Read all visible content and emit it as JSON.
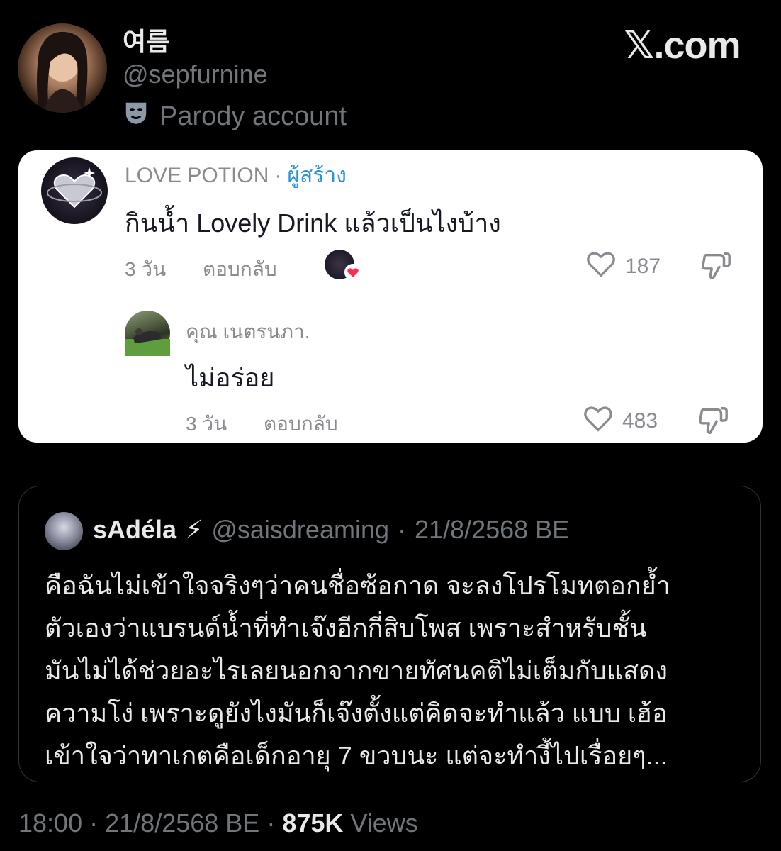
{
  "author": {
    "display_name": "여름",
    "handle": "@sepfurnine",
    "parody_label": "Parody account",
    "parody_icon": "mask-icon"
  },
  "brand": "𝕏.com",
  "screenshot": {
    "comment": {
      "author": "LOVE POTION",
      "separator": "·",
      "creator_label": "ผู้สร้าง",
      "text": "กินน้ำ Lovely Drink แล้วเป็นไงบ้าง",
      "time": "3 วัน",
      "reply_label": "ตอบกลับ",
      "likes": "187"
    },
    "reply": {
      "author": "คุณ เนตรนภา.",
      "text": "ไม่อร่อย",
      "time": "3 วัน",
      "reply_label": "ตอบกลับ",
      "likes": "483"
    }
  },
  "quote": {
    "name": "sAdéla",
    "emoji": "⚡",
    "handle": "@saisdreaming",
    "separator": "·",
    "date": "21/8/2568 BE",
    "lines": [
      "คือฉันไม่เข้าใจจริงๆว่าคนชื่อซ้อกาด จะลงโปรโมทตอกย้ำ",
      "ตัวเองว่าแบรนด์น้ำที่ทำเจ๊งอีกกี่สิบโพส เพราะสำหรับชั้น",
      "มันไม่ได้ช่วยอะไรเลยนอกจากขายทัศนคติไม่เต็มกับแสดง",
      "ความโง่ เพราะดูยังไงมันก็เจ๊งตั้งแต่คิดจะทำแล้ว แบบ เฮ้อ",
      "เข้าใจว่าทาเกตคือเด็กอายุ 7 ขวบนะ แต่จะทำงี้ไปเรื่อยๆ..."
    ]
  },
  "footer": {
    "time": "18:00",
    "separator": "·",
    "date": "21/8/2568 BE",
    "views_count": "875K",
    "views_label": "Views"
  }
}
